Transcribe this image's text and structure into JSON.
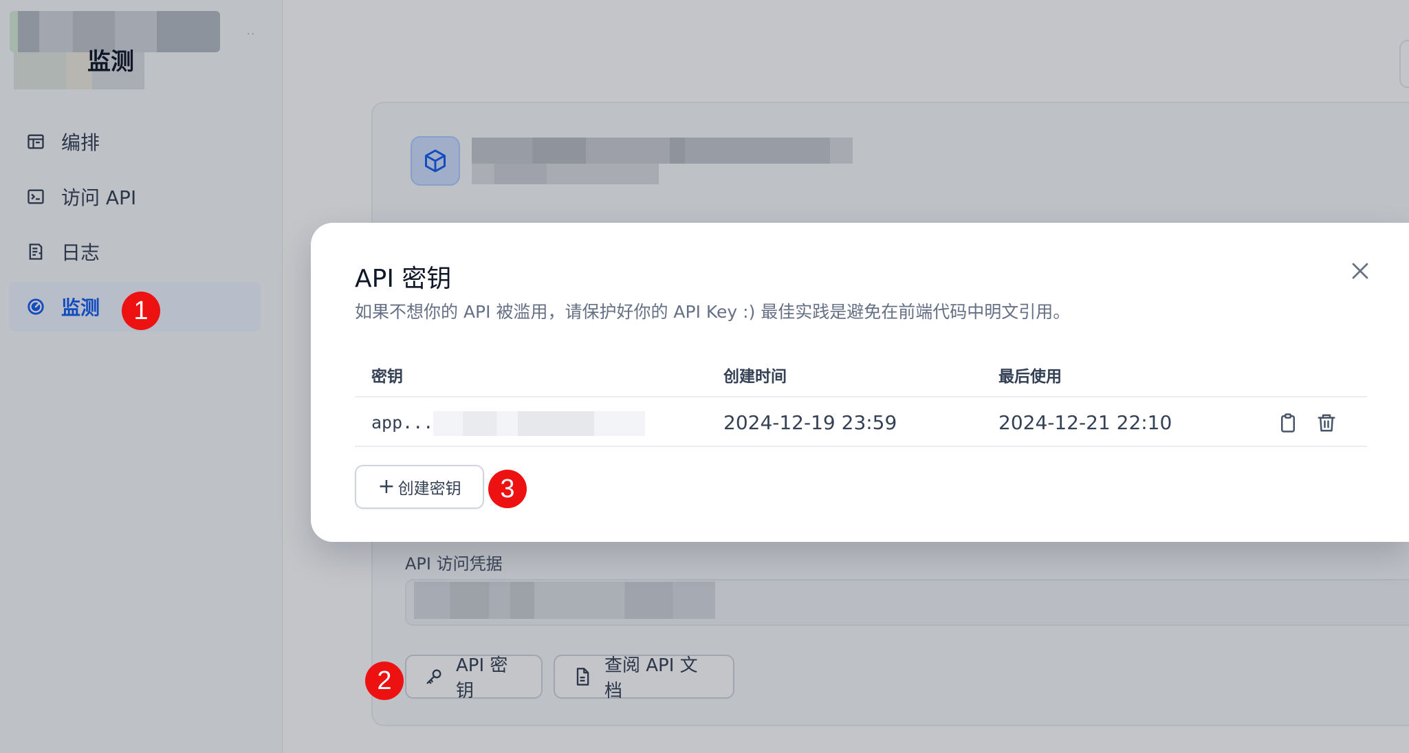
{
  "sidebar": {
    "items": [
      {
        "label": "编排",
        "icon": "layout-icon"
      },
      {
        "label": "访问 API",
        "icon": "terminal-icon"
      },
      {
        "label": "日志",
        "icon": "file-list-icon"
      },
      {
        "label": "监测",
        "icon": "dashboard-gauge-icon",
        "active": true
      }
    ]
  },
  "main": {
    "title": "监测",
    "credential_label": "API 访问凭据",
    "buttons": {
      "api_key": "API 密钥",
      "view_docs": "查阅 API 文档"
    }
  },
  "modal": {
    "title": "API 密钥",
    "description": "如果不想你的 API 被滥用，请保护好你的 API Key :) 最佳实践是避免在前端代码中明文引用。",
    "columns": [
      "密钥",
      "创建时间",
      "最后使用"
    ],
    "rows": [
      {
        "key": "app...",
        "created": "2024-12-19 23:59",
        "last_used": "2024-12-21 22:10"
      }
    ],
    "create_button": "创建密钥",
    "create_button_icon": "plus"
  },
  "annotations": [
    "1",
    "2",
    "3"
  ],
  "colors": {
    "accent": "#155eef",
    "badge": "#ee1111",
    "active_bg": "#eff4ff"
  }
}
